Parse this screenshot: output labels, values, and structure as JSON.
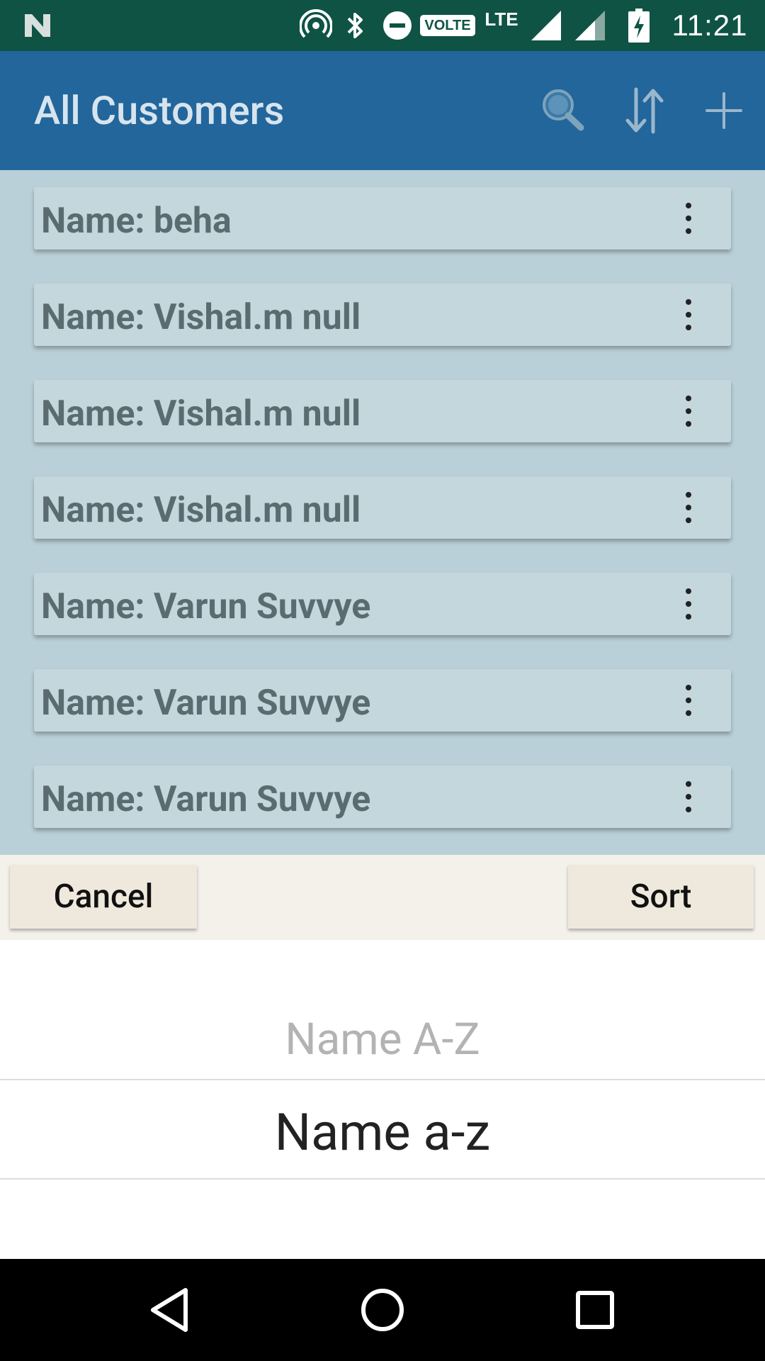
{
  "status_bar": {
    "time": "11:21",
    "volte": "VOLTE",
    "network": "LTE",
    "icons": [
      "notification-n-icon",
      "hotspot-icon",
      "bluetooth-icon",
      "do-not-disturb-icon",
      "signal-icon",
      "signal-icon-2",
      "battery-charging-icon"
    ]
  },
  "app_bar": {
    "title": "All Customers",
    "actions": [
      "search-icon",
      "sort-icon",
      "add-icon"
    ]
  },
  "customers": [
    {
      "label": "Name: beha"
    },
    {
      "label": "Name: Vishal.m null"
    },
    {
      "label": "Name: Vishal.m null"
    },
    {
      "label": "Name: Vishal.m null"
    },
    {
      "label": "Name: Varun Suvvye"
    },
    {
      "label": "Name: Varun Suvvye"
    },
    {
      "label": "Name: Varun Suvvye"
    }
  ],
  "picker": {
    "cancel_label": "Cancel",
    "sort_label": "Sort",
    "options": [
      "Name A-Z",
      "Name a-z"
    ],
    "selected": "Name a-z"
  },
  "colors": {
    "status_bar": "#0f5345",
    "app_bar": "#22669b",
    "list_bg": "#b9d0d8",
    "card_bg": "#c3d7dc"
  }
}
